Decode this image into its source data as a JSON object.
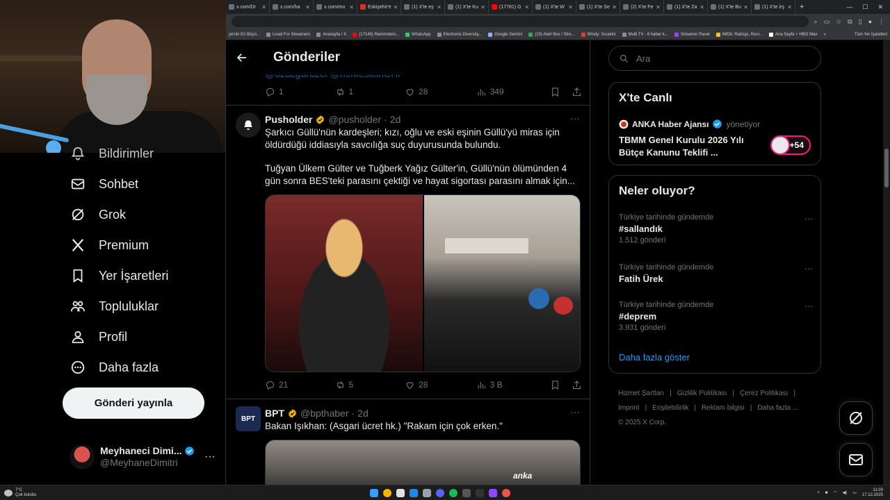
{
  "browser": {
    "tabs": [
      {
        "label": "x.com/Dr"
      },
      {
        "label": "x.com/ha"
      },
      {
        "label": "x.com/mo"
      },
      {
        "label": "Eskişehir'e"
      },
      {
        "label": "(1) X'te eş"
      },
      {
        "label": "(1) X'te Ku"
      },
      {
        "label": "(17781) G"
      },
      {
        "label": "(1) X'te W"
      },
      {
        "label": "(1) X'te Se"
      },
      {
        "label": "(2) X'te Fe"
      },
      {
        "label": "(1) X'te Za"
      },
      {
        "label": "(1) X'te Bu"
      },
      {
        "label": "(1) X'te İrş"
      }
    ],
    "new_tab": "+",
    "bookmarks": [
      "ye'nin En Büyü...",
      "Livad For Streamers",
      "Anasayfa / X",
      "(17145) Rammstein...",
      "WhatsApp",
      "Electronic Diversity...",
      "Google Gemini",
      "(19) Alert Box / Stre...",
      "Windy: Sıcaklık",
      "Multi TV - 6 haber k...",
      "Streamer Panel",
      "IMDb: Ratings, Revi...",
      "Ana Sayfa + HBO Max"
    ],
    "bookmarks_more": "»",
    "all_bookmarks": "Tüm Yer İşaretleri"
  },
  "nav": {
    "items": [
      {
        "label": "Bildirimler",
        "icon": "bell-icon"
      },
      {
        "label": "Sohbet",
        "icon": "mail-icon"
      },
      {
        "label": "Grok",
        "icon": "grok-icon"
      },
      {
        "label": "Premium",
        "icon": "x-logo-icon"
      },
      {
        "label": "Yer İşaretleri",
        "icon": "bookmark-icon"
      },
      {
        "label": "Topluluklar",
        "icon": "communities-icon"
      },
      {
        "label": "Profil",
        "icon": "person-icon"
      },
      {
        "label": "Daha fazla",
        "icon": "more-circle-icon"
      }
    ],
    "post_button": "Gönderi yayınla",
    "account": {
      "name": "Meyhaneci Dimi...",
      "handle": "@MeyhaneDimitri",
      "more": "···"
    }
  },
  "center": {
    "title": "Gönderiler",
    "prev_mention": "@ozozgurozel @herkesicinCHP",
    "prev_actions": {
      "replies": "1",
      "reposts": "1",
      "likes": "28",
      "views": "349"
    },
    "tweets": [
      {
        "name": "Pusholder",
        "handle": "@pusholder",
        "sep": "·",
        "time": "2d",
        "text1": "Şarkıcı Güllü'nün kardeşleri; kızı, oğlu ve eski eşinin Güllü'yü miras için öldürdüğü iddiasıyla savcılığa suç duyurusunda bulundu.",
        "text2": "Tuğyan Ülkem Gülter ve Tuğberk Yağız Gülter'in, Güllü'nün ölümünden 4 gün sonra BES'teki parasını çektiği ve hayat sigortası parasını almak için...",
        "actions": {
          "replies": "21",
          "reposts": "5",
          "likes": "28",
          "views": "3 B"
        }
      },
      {
        "name": "BPT",
        "handle": "@bpthaber",
        "sep": "·",
        "time": "2d",
        "avatar_text": "BPT",
        "text1": "Bakan Işıkhan: (Asgari ücret hk.) \"Rakam için çok erken.\"",
        "media_caption": "anka"
      }
    ],
    "more": "···"
  },
  "right": {
    "search_placeholder": "Ara",
    "live": {
      "title": "X'te Canlı",
      "source": "ANKA Haber Ajansı",
      "role": "yönetiyor",
      "headline": "TBMM Genel Kurulu 2026 Yılı Bütçe Kanunu Teklifi ...",
      "count": "+54"
    },
    "trends_title": "Neler oluyor?",
    "trends": [
      {
        "context": "Türkiye tarihinde gündemde",
        "name": "#sallandık",
        "count": "1.512 gönderi"
      },
      {
        "context": "Türkiye tarihinde gündemde",
        "name": "Fatih Ürek",
        "count": ""
      },
      {
        "context": "Türkiye tarihinde gündemde",
        "name": "#deprem",
        "count": "3.931 gönderi"
      }
    ],
    "show_more": "Daha fazla göster",
    "footer_links": [
      "Hizmet Şartları",
      "|",
      "Gizlilik Politikası",
      "|",
      "Çerez Politikası",
      "|",
      "Imprint",
      "|",
      "Erişilebilirlik",
      "|",
      "Reklam bilgisi",
      "|",
      "Daha fazla ..."
    ],
    "copyright": "© 2025 X Corp."
  },
  "taskbar": {
    "temp": "7°C",
    "weather": "Çok bulutlu",
    "time": "11:03",
    "date": "17.12.2025"
  },
  "colors": {
    "accent": "#1d9bf0",
    "verified": "#f4b400",
    "live": "#f91880"
  }
}
